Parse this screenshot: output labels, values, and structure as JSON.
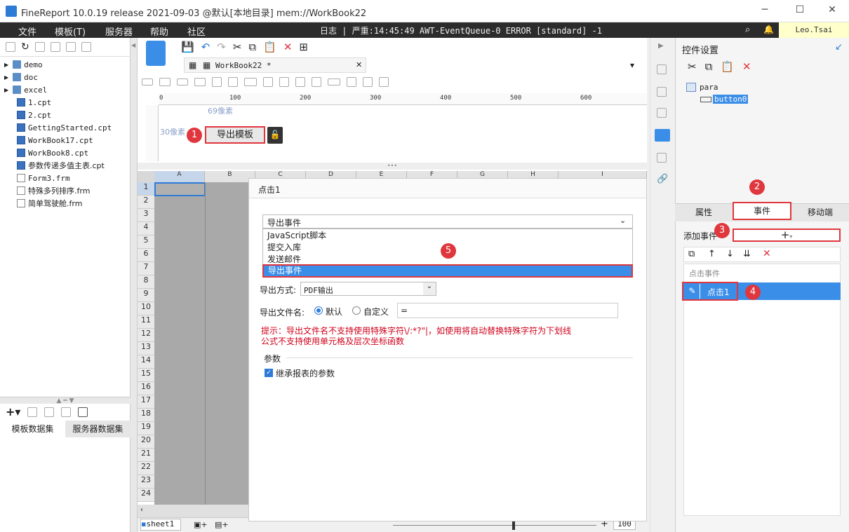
{
  "titlebar": {
    "title": "FineReport 10.0.19 release 2021-09-03 @默认[本地目录]    mem://WorkBook22"
  },
  "menubar": {
    "items": [
      "文件",
      "模板(T)",
      "服务器",
      "帮助",
      "社区"
    ],
    "log": "日志 | 严重:14:45:49 AWT-EventQueue-0 ERROR [standard] -1",
    "user": "Leo.Tsai"
  },
  "tree": {
    "items": [
      "demo",
      "doc",
      "excel",
      "1.cpt",
      "2.cpt",
      "GettingStarted.cpt",
      "WorkBook17.cpt",
      "WorkBook8.cpt",
      "参数传递多值主表.cpt",
      "Form3.frm",
      "特殊多列排序.frm",
      "简单驾驶舱.frm"
    ]
  },
  "leftbottom": {
    "tab1": "模板数据集",
    "tab2": "服务器数据集"
  },
  "center": {
    "tab": "WorkBook22 *",
    "ruler": [
      "0",
      "100",
      "200",
      "300",
      "400",
      "500",
      "600"
    ],
    "label69": "69像素",
    "label30": "30像素",
    "button": "导出模板"
  },
  "sheet": {
    "columns": [
      "A",
      "B",
      "C",
      "D",
      "E",
      "F",
      "G",
      "H",
      "I"
    ],
    "rows": [
      "1",
      "2",
      "3",
      "4",
      "5",
      "6",
      "7",
      "8",
      "9",
      "10",
      "11",
      "12",
      "13",
      "14",
      "15",
      "16",
      "17",
      "18",
      "19",
      "20",
      "21",
      "22",
      "23",
      "24"
    ],
    "tab": "sheet1",
    "zoom": "100"
  },
  "dialog": {
    "title": "点击1",
    "select": "导出事件",
    "options": [
      "JavaScript脚本",
      "提交入库",
      "发送邮件",
      "导出事件"
    ],
    "exportMode_label": "导出方式:",
    "exportMode_value": "PDF输出",
    "filename_label": "导出文件名:",
    "radio_default": "默认",
    "radio_custom": "自定义",
    "filename_value": "=",
    "warn1": "提示：导出文件名不支持使用特殊字符\\/:*?\"|，如使用将自动替换特殊字符为下划线",
    "warn2": "公式不支持使用单元格及层次坐标函数",
    "params_label": "参数",
    "inherit_label": "继承报表的参数"
  },
  "right": {
    "title": "控件设置",
    "tree_root": "para",
    "tree_child": "button0",
    "tabs": [
      "属性",
      "事件",
      "移动端"
    ],
    "add_event": "添加事件",
    "event_header": "点击事件",
    "event_item": "点击1"
  },
  "badges": [
    "1",
    "2",
    "3",
    "4",
    "5"
  ],
  "colors": {
    "accent": "#3b8ee8",
    "red": "#e0363d",
    "menubar": "#2c2c2c"
  }
}
